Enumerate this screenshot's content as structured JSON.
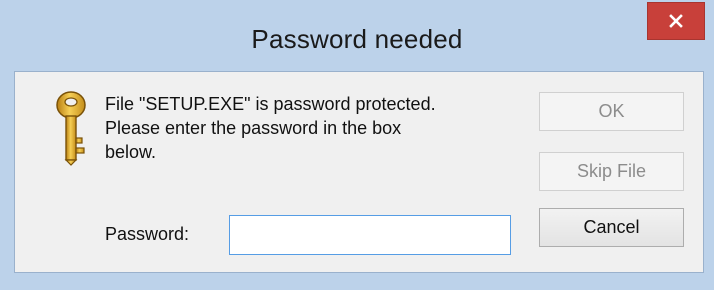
{
  "window": {
    "title": "Password needed",
    "close_icon": "close-icon"
  },
  "dialog": {
    "icon": "key-icon",
    "message_lines": [
      "File \"SETUP.EXE\" is password protected.",
      "Please enter the password in the box",
      "below."
    ],
    "password_label": "Password:",
    "password_value": ""
  },
  "buttons": {
    "ok": {
      "label": "OK",
      "enabled": false
    },
    "skip": {
      "label": "Skip File",
      "enabled": false
    },
    "cancel": {
      "label": "Cancel",
      "enabled": true
    }
  },
  "colors": {
    "frame": "#bcd2ea",
    "close_button": "#c8403a",
    "client_background": "#f0f0f0",
    "input_focus_border": "#569de5"
  }
}
